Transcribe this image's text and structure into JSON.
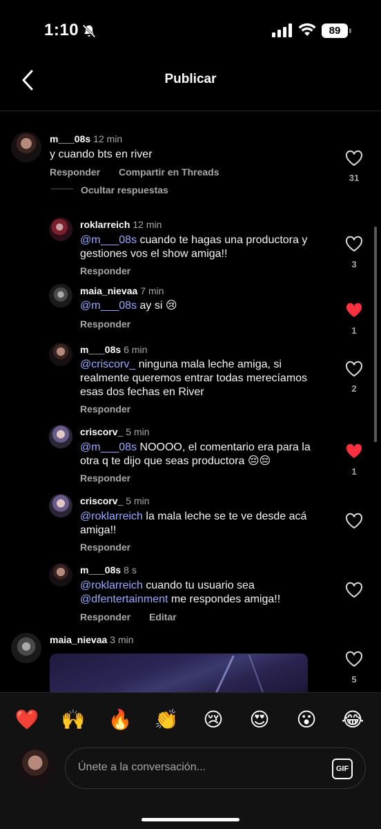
{
  "status_bar": {
    "time": "1:10",
    "battery": "89"
  },
  "header": {
    "title": "Publicar"
  },
  "comments": [
    {
      "user": "m___08s",
      "time": "12 min",
      "text": "y cuando bts en river",
      "reply": "Responder",
      "share": "Compartir en Threads",
      "hide": "Ocultar respuestas",
      "likes": "31",
      "liked": false
    },
    {
      "user": "roklarreich",
      "time": "12 min",
      "mention": "@m___08s",
      "text": " cuando te hagas una productora y gestiones vos el show amiga!!",
      "reply": "Responder",
      "likes": "3",
      "liked": false
    },
    {
      "user": "maia_nievaa",
      "time": "7 min",
      "mention": "@m___08s",
      "text": " ay si 😢",
      "reply": "Responder",
      "likes": "1",
      "liked": true
    },
    {
      "user": "m___08s",
      "time": "6 min",
      "mention": "@criscorv_",
      "text": " ninguna mala leche amiga, si realmente queremos entrar todas merecíamos esas dos fechas en River",
      "reply": "Responder",
      "likes": "2",
      "liked": false
    },
    {
      "user": "criscorv_",
      "time": "5 min",
      "mention": "@m___08s",
      "text": " NOOOO, el comentario era para la otra q te dijo que seas productora 😔😔",
      "reply": "Responder",
      "likes": "1",
      "liked": true
    },
    {
      "user": "criscorv_",
      "time": "5 min",
      "mention": "@roklarreich",
      "text": " la mala leche se te ve desde acá amiga!!",
      "reply": "Responder",
      "likes": "",
      "liked": false
    },
    {
      "user": "m___08s",
      "time": "8 s",
      "mention": "@roklarreich",
      "text": " cuando tu usuario sea ",
      "mention2": "@dfentertainment",
      "text2": " me respondes amiga!!",
      "reply": "Responder",
      "edit": "Editar",
      "likes": "",
      "liked": false
    },
    {
      "user": "maia_nievaa",
      "time": "3 min",
      "likes": "5",
      "liked": false
    }
  ],
  "emojis": [
    "❤️",
    "🙌",
    "🔥",
    "👏",
    "😢",
    "😍",
    "😮",
    "😂"
  ],
  "composer": {
    "placeholder": "Únete a la conversación...",
    "gif_label": "GIF"
  },
  "colors": {
    "background": "#000000",
    "mention": "#9aa8ff",
    "like_red": "#ff3040",
    "muted": "#a8a8a8"
  }
}
